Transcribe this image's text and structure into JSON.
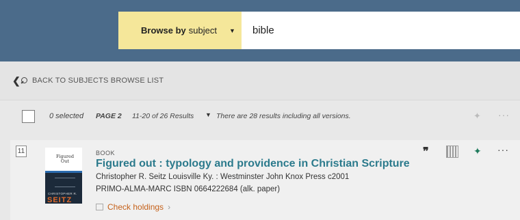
{
  "search": {
    "browse_prefix": "Browse by",
    "browse_value": "subject",
    "query": "bible"
  },
  "nav": {
    "back_label": "BACK TO SUBJECTS BROWSE LIST"
  },
  "results_bar": {
    "selected": "0 selected",
    "page": "PAGE 2",
    "range": "11-20 of 26 Results",
    "versions_note": "There are 28 results including all versions."
  },
  "result": {
    "number": "11",
    "cover": {
      "title_text": "Figured Out",
      "author_text": "CHRISTOPHER R.",
      "author_surname": "SEITZ"
    },
    "format": "BOOK",
    "title": "Figured out : typology and providence in Christian Scripture",
    "meta_line1": "Christopher R. Seitz Louisville Ky. : Westminster John Knox Press c2001",
    "meta_line2": "PRIMO-ALMA-MARC ISBN 0664222684 (alk. paper)",
    "holdings_label": "Check holdings",
    "holdings_arrow": "›"
  },
  "icons": {
    "caret": "▼",
    "chevron_left": "❮",
    "quote": "❞",
    "pin": "✦",
    "more": "···"
  },
  "colors": {
    "header_bg": "#4b6b8a",
    "browse_bg": "#f5e79a",
    "title_link": "#2b7a8c",
    "holdings_link": "#c5611a",
    "pin_active": "#1e7a5c"
  }
}
